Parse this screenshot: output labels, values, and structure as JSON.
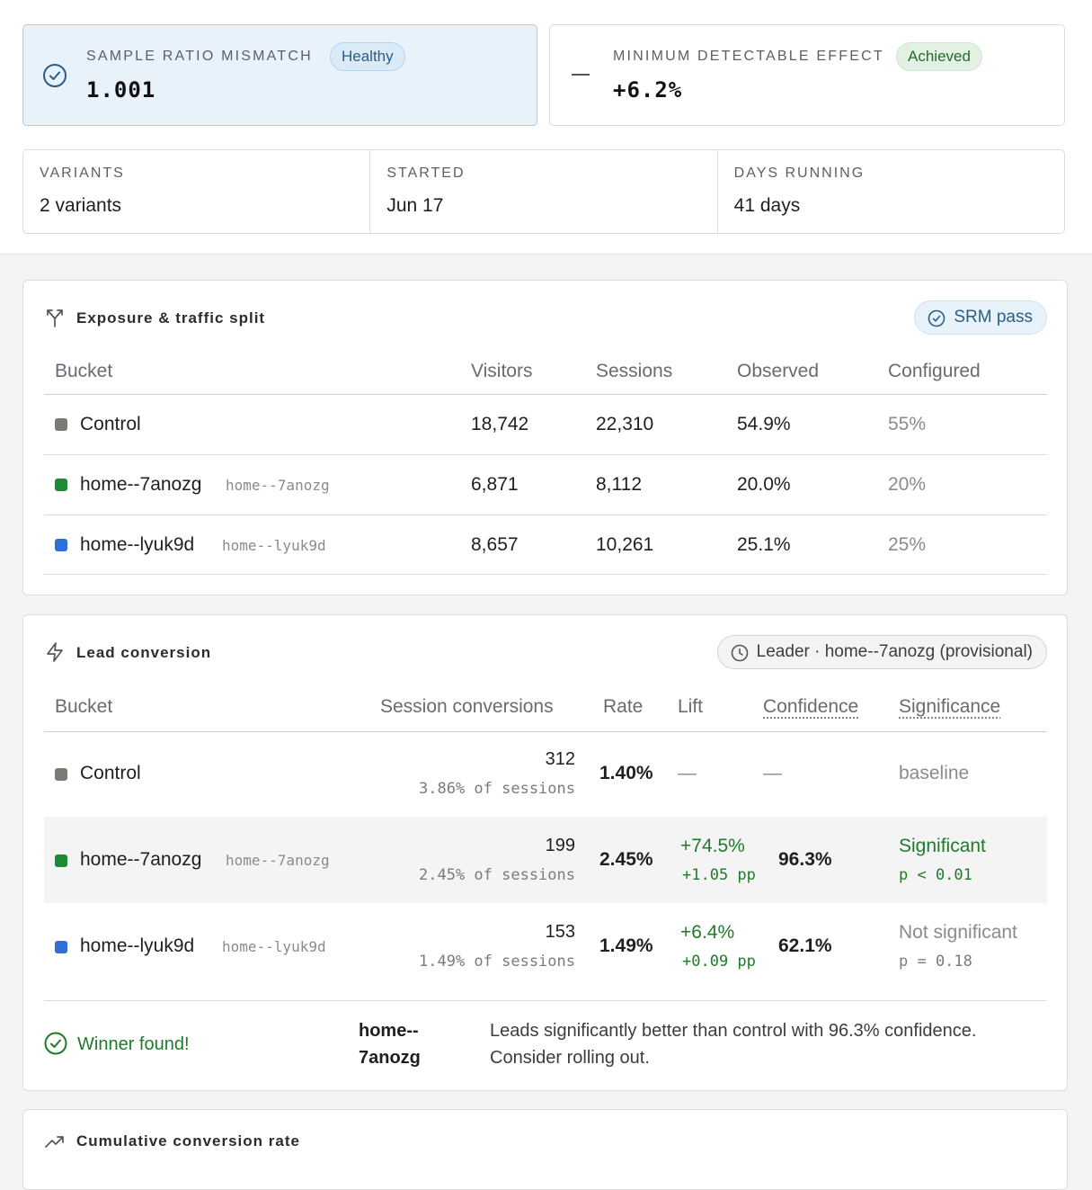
{
  "srm": {
    "label": "SAMPLE RATIO MISMATCH",
    "badge": "Healthy",
    "value": "1.001",
    "icon": "check-circle-icon"
  },
  "mde": {
    "label": "MINIMUM DETECTABLE EFFECT",
    "badge": "Achieved",
    "value": "+6.2%",
    "icon": "dash-icon"
  },
  "meta": [
    {
      "label": "VARIANTS",
      "value": "2 variants"
    },
    {
      "label": "STARTED",
      "value": "Jun 17"
    },
    {
      "label": "DAYS RUNNING",
      "value": "41 days"
    }
  ],
  "exposure": {
    "title": "Exposure & traffic split",
    "icon": "split-arrows-icon",
    "badge": "SRM pass",
    "headers": [
      "Bucket",
      "Visitors",
      "Sessions",
      "Observed",
      "Configured"
    ],
    "rows": [
      {
        "name": "Control",
        "alias": "",
        "color": "#7d7a76",
        "visitors": "18,742",
        "sessions": "22,310",
        "observed": "54.9%",
        "configured": "55%"
      },
      {
        "name": "home--7anozg",
        "alias": "home--7anozg",
        "color": "#1f8a34",
        "visitors": "6,871",
        "sessions": "8,112",
        "observed": "20.0%",
        "configured": "20%"
      },
      {
        "name": "home--lyuk9d",
        "alias": "home--lyuk9d",
        "color": "#2f6fd6",
        "visitors": "8,657",
        "sessions": "10,261",
        "observed": "25.1%",
        "configured": "25%"
      }
    ]
  },
  "conversion": {
    "title": "Lead conversion",
    "icon": "lightning-icon",
    "badge": "Leader · home--7anozg (provisional)",
    "headers": [
      "Bucket",
      "Session conversions",
      "Rate",
      "Lift",
      "Confidence",
      "Significance"
    ],
    "rows": [
      {
        "name": "Control",
        "alias": "",
        "conversions": "312",
        "share": "3.86% of sessions",
        "rate": "1.40%",
        "lift": "—",
        "lift_pp": "",
        "confidence": "—",
        "significance": "baseline",
        "p": ""
      },
      {
        "name": "home--7anozg",
        "alias": "home--7anozg",
        "conversions": "199",
        "share": "2.45% of sessions",
        "rate": "2.45%",
        "lift": "+74.5%",
        "lift_pp": "+1.05 pp",
        "confidence": "96.3%",
        "significance": "Significant",
        "p": "p < 0.01"
      },
      {
        "name": "home--lyuk9d",
        "alias": "home--lyuk9d",
        "conversions": "153",
        "share": "1.49% of sessions",
        "rate": "1.49%",
        "lift": "+6.4%",
        "lift_pp": "+0.09 pp",
        "confidence": "62.1%",
        "significance": "Not significant",
        "p": "p = 0.18"
      }
    ],
    "winner": {
      "label": "Winner found!",
      "bucket_line1": "home--",
      "bucket_line2": "7anozg",
      "message_line1": "Leads significantly better than control with 96.3% confidence.",
      "message_line2": "Consider rolling out."
    }
  },
  "cumulative": {
    "title": "Cumulative conversion rate",
    "icon": "trend-up-icon"
  },
  "colors": {
    "accent_blue": "#2b5d86",
    "success_green": "#1f7a2c",
    "control": "#7d7a76",
    "variant_a": "#1f8a34",
    "variant_b": "#2f6fd6"
  }
}
